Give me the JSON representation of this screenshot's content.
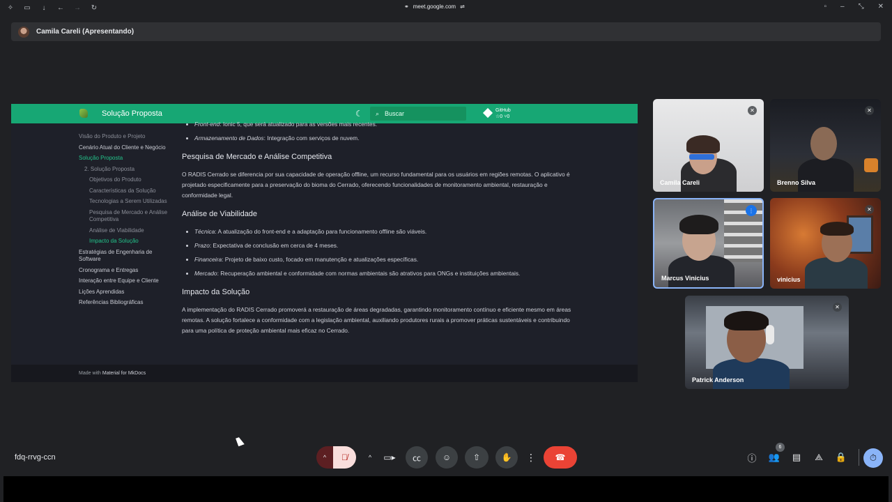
{
  "browser": {
    "url": "meet.google.com",
    "icons": [
      "extensions-icon",
      "tabs-icon",
      "download-icon",
      "back-icon",
      "forward-icon",
      "reload-icon"
    ]
  },
  "presenter": {
    "label": "Camila Careli (Apresentando)"
  },
  "shared_screen": {
    "header": {
      "title": "Solução Proposta",
      "search_placeholder": "Buscar",
      "github_label": "GitHub",
      "github_stats": "☆0  ⑂0"
    },
    "nav": [
      {
        "label": "Visão do Produto e Projeto",
        "level": 0,
        "faded": true
      },
      {
        "label": "Cenário Atual do Cliente e Negócio",
        "level": 0
      },
      {
        "label": "Solução Proposta",
        "level": 0,
        "active": true
      },
      {
        "label": "2. Solução Proposta",
        "level": 1
      },
      {
        "label": "Objetivos do Produto",
        "level": 2
      },
      {
        "label": "Características da Solução",
        "level": 2
      },
      {
        "label": "Tecnologias a Serem Utilizadas",
        "level": 2
      },
      {
        "label": "Pesquisa de Mercado e Análise Competitiva",
        "level": 2
      },
      {
        "label": "Análise de Viabilidade",
        "level": 2
      },
      {
        "label": "Impacto da Solução",
        "level": 2,
        "active": true
      },
      {
        "label": "Estratégias de Engenharia de Software",
        "level": 0
      },
      {
        "label": "Cronograma e Entregas",
        "level": 0
      },
      {
        "label": "Interação entre Equipe e Cliente",
        "level": 0
      },
      {
        "label": "Lições Aprendidas",
        "level": 0
      },
      {
        "label": "Referências Bibliográficas",
        "level": 0
      }
    ],
    "content": {
      "top_bullets": [
        {
          "term": "Front-end",
          "text": ": Ionic 5, que será atualizado para as versões mais recentes."
        },
        {
          "term": "Armazenamento de Dados",
          "text": ": Integração com serviços de nuvem."
        }
      ],
      "section1_title": "Pesquisa de Mercado e Análise Competitiva",
      "section1_text": "O RADIS Cerrado se diferencia por sua capacidade de operação offline, um recurso fundamental para os usuários em regiões remotas. O aplicativo é projetado especificamente para a preservação do bioma do Cerrado, oferecendo funcionalidades de monitoramento ambiental, restauração e conformidade legal.",
      "section2_title": "Análise de Viabilidade",
      "section2_bullets": [
        {
          "term": "Técnica",
          "text": ": A atualização do front-end e a adaptação para funcionamento offline são viáveis."
        },
        {
          "term": "Prazo",
          "text": ": Expectativa de conclusão em cerca de 4 meses."
        },
        {
          "term": "Financeira",
          "text": ": Projeto de baixo custo, focado em manutenção e atualizações específicas."
        },
        {
          "term": "Mercado",
          "text": ": Recuperação ambiental e conformidade com normas ambientais são atrativos para ONGs e instituições ambientais."
        }
      ],
      "section3_title": "Impacto da Solução",
      "section3_text": "A implementação do RADIS Cerrado promoverá a restauração de áreas degradadas, garantindo monitoramento contínuo e eficiente mesmo em áreas remotas. A solução fortalece a conformidade com a legislação ambiental, auxiliando produtores rurais a promover práticas sustentáveis e contribuindo para uma política de proteção ambiental mais eficaz no Cerrado."
    },
    "footer": {
      "prefix": "Made with",
      "link": "Material for MkDocs"
    }
  },
  "participants": [
    {
      "name": "Camila Careli",
      "muted": true
    },
    {
      "name": "Brenno Silva",
      "muted": true
    },
    {
      "name": "Marcus Vinicius",
      "speaking": true
    },
    {
      "name": "vinicius",
      "muted": true
    },
    {
      "name": "Patrick Anderson",
      "muted": true
    }
  ],
  "bottom_bar": {
    "meeting_code": "fdq-rrvg-ccn",
    "people_count": "6"
  }
}
